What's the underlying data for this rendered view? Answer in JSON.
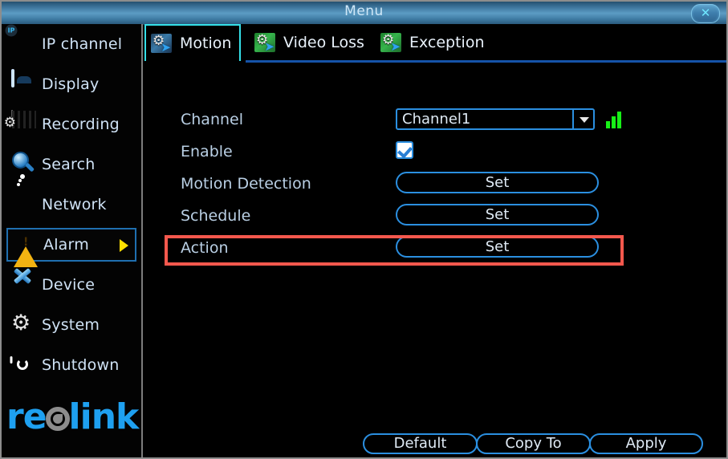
{
  "window": {
    "title": "Menu",
    "close_label": "✕"
  },
  "sidebar": {
    "items": [
      {
        "label": "IP channel",
        "icon": "ip-camera-icon",
        "selected": false
      },
      {
        "label": "Display",
        "icon": "display-icon",
        "selected": false
      },
      {
        "label": "Recording",
        "icon": "recording-icon",
        "selected": false
      },
      {
        "label": "Search",
        "icon": "search-icon",
        "selected": false
      },
      {
        "label": "Network",
        "icon": "network-icon",
        "selected": false
      },
      {
        "label": "Alarm",
        "icon": "alarm-warning-icon",
        "selected": true
      },
      {
        "label": "Device",
        "icon": "device-tools-icon",
        "selected": false
      },
      {
        "label": "System",
        "icon": "system-gear-icon",
        "selected": false
      },
      {
        "label": "Shutdown",
        "icon": "power-icon",
        "selected": false
      }
    ],
    "logo": {
      "part1": "re",
      "part2": "link"
    }
  },
  "tabs": [
    {
      "label": "Motion",
      "icon": "motion-gear-arrow-icon",
      "active": true
    },
    {
      "label": "Video Loss",
      "icon": "videoloss-gear-arrow-icon",
      "active": false
    },
    {
      "label": "Exception",
      "icon": "exception-gear-arrow-icon",
      "active": false
    }
  ],
  "form": {
    "channel": {
      "label": "Channel",
      "value": "Channel1",
      "signal_icon": "signal-bars-icon"
    },
    "enable": {
      "label": "Enable",
      "checked": true
    },
    "motion_detection": {
      "label": "Motion Detection",
      "button": "Set"
    },
    "schedule": {
      "label": "Schedule",
      "button": "Set"
    },
    "action": {
      "label": "Action",
      "button": "Set",
      "highlighted": true,
      "highlight_color": "#f4584d"
    }
  },
  "footer": {
    "default_label": "Default",
    "copy_to_label": "Copy To",
    "apply_label": "Apply"
  },
  "colors": {
    "accent_blue": "#2b8fe0",
    "tab_active": "#35e0e8",
    "selected_nav": "#1f6fb0",
    "highlight_red": "#f4584d",
    "signal_green": "#17f017",
    "logo_blue": "#1ea0f0"
  }
}
